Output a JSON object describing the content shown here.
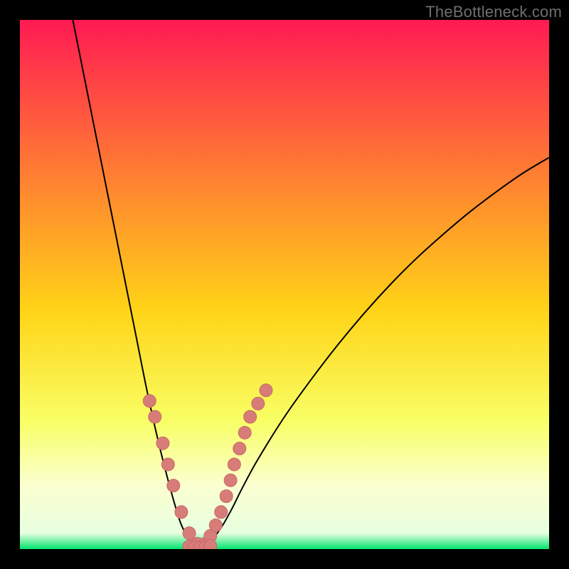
{
  "watermark": "TheBottleneck.com",
  "colors": {
    "bg": "#000000",
    "gradient_top": "#ff1a53",
    "gradient_mid_upper": "#ff7a33",
    "gradient_mid": "#ffd417",
    "gradient_lower": "#f8ff66",
    "gradient_pale": "#fbffd0",
    "gradient_bottom": "#00e46d",
    "curve": "#000000",
    "marker_fill": "#d77c79",
    "marker_stroke": "#c96a66"
  },
  "chart_data": {
    "type": "line",
    "title": "",
    "xlabel": "",
    "ylabel": "",
    "xlim": [
      0,
      100
    ],
    "ylim": [
      0,
      100
    ],
    "series": [
      {
        "name": "curve-left",
        "x": [
          10,
          12,
          14,
          16,
          18,
          20,
          22,
          24,
          26,
          28,
          30,
          31,
          32,
          33,
          34
        ],
        "y": [
          100,
          90,
          80,
          70,
          60,
          50,
          40,
          30,
          21,
          13,
          6,
          3.5,
          1.8,
          0.7,
          0.2
        ]
      },
      {
        "name": "curve-right",
        "x": [
          34,
          36,
          38,
          40,
          42,
          45,
          50,
          55,
          60,
          65,
          70,
          75,
          80,
          85,
          90,
          95,
          100
        ],
        "y": [
          0.2,
          1.5,
          4,
          7.5,
          11.5,
          17,
          25,
          32,
          38.5,
          44.5,
          50,
          55,
          59.5,
          63.7,
          67.5,
          71,
          74
        ]
      },
      {
        "name": "markers-left",
        "x": [
          24.5,
          25.5,
          27,
          28,
          29,
          30.5,
          32,
          33.5
        ],
        "y": [
          28,
          25,
          20,
          16,
          12,
          7,
          3,
          1
        ]
      },
      {
        "name": "markers-right",
        "x": [
          35,
          36,
          37,
          38,
          39,
          39.8,
          40.5,
          41.5,
          42.5,
          43.5,
          45,
          46.5
        ],
        "y": [
          1,
          2.5,
          4.5,
          7,
          10,
          13,
          16,
          19,
          22,
          25,
          27.5,
          30
        ]
      },
      {
        "name": "markers-bottom",
        "x": [
          32,
          33,
          34,
          35,
          36
        ],
        "y": [
          0.5,
          0.3,
          0.2,
          0.3,
          0.6
        ]
      }
    ],
    "gradient_stops": [
      {
        "offset": 0.0,
        "color": "#ff1a53"
      },
      {
        "offset": 0.28,
        "color": "#ff7a33"
      },
      {
        "offset": 0.55,
        "color": "#ffd417"
      },
      {
        "offset": 0.76,
        "color": "#f8ff66"
      },
      {
        "offset": 0.88,
        "color": "#fbffd0"
      },
      {
        "offset": 0.97,
        "color": "#e7ffe0"
      },
      {
        "offset": 1.0,
        "color": "#00e46d"
      }
    ]
  }
}
